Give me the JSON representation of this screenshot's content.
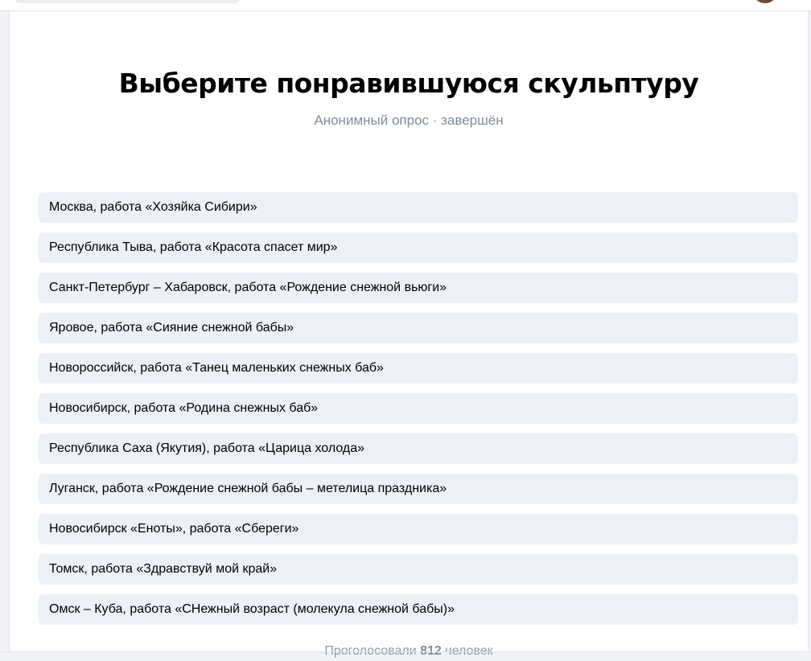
{
  "poll": {
    "title": "Выберите понравившуюся скульптуру",
    "subtitle": "Анонимный опрос · завершён",
    "options": [
      {
        "label": "Москва, работа «Хозяйка Сибири»"
      },
      {
        "label": "Республика Тыва, работа «Красота спасет мир»"
      },
      {
        "label": "Санкт-Петербург – Хабаровск, работа «Рождение снежной вьюги»"
      },
      {
        "label": "Яровое, работа «Сияние снежной бабы»"
      },
      {
        "label": "Новороссийск, работа «Танец маленьких снежных баб»"
      },
      {
        "label": "Новосибирск, работа «Родина снежных баб»"
      },
      {
        "label": "Республика Саха (Якутия), работа «Царица холода»"
      },
      {
        "label": "Луганск, работа «Рождение снежной бабы – метелица праздника»"
      },
      {
        "label": "Новосибирск «Еноты», работа «Сбереги»"
      },
      {
        "label": "Томск, работа «Здравствуй мой край»"
      },
      {
        "label": "Омск – Куба, работа «СНежный возраст (молекула снежной бабы)»"
      }
    ],
    "footer": {
      "prefix": "Проголосовали",
      "count": "812",
      "suffix": "человек"
    }
  },
  "colors": {
    "option_bg": "#edf0f6",
    "subtitle": "#818c99",
    "page_bg": "#f0f2f5"
  }
}
